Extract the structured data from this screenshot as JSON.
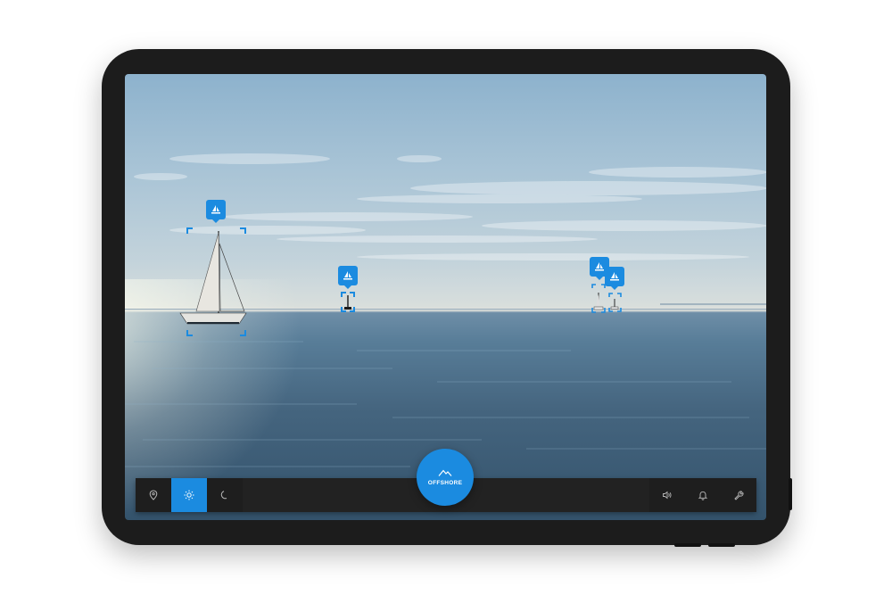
{
  "colors": {
    "accent": "#1b8be0",
    "frame": "#1c1c1c",
    "toolbar": "#222222"
  },
  "markers": [
    {
      "icon": "sailboat-icon",
      "label": "sailboat-1"
    },
    {
      "icon": "sailboat-icon",
      "label": "sailboat-2"
    },
    {
      "icon": "sailboat-icon",
      "label": "sailboat-3"
    },
    {
      "icon": "sailboat-icon",
      "label": "sailboat-4"
    }
  ],
  "toolbar": {
    "left_buttons": [
      {
        "icon": "location-pin-icon",
        "active": false
      },
      {
        "icon": "sun-icon",
        "active": true
      },
      {
        "icon": "moon-icon",
        "active": false
      }
    ],
    "mode_button": {
      "icon": "mountain-icon",
      "label": "OFFSHORE"
    },
    "right_buttons": [
      {
        "icon": "speaker-icon"
      },
      {
        "icon": "bell-icon"
      },
      {
        "icon": "wrench-icon"
      }
    ]
  }
}
